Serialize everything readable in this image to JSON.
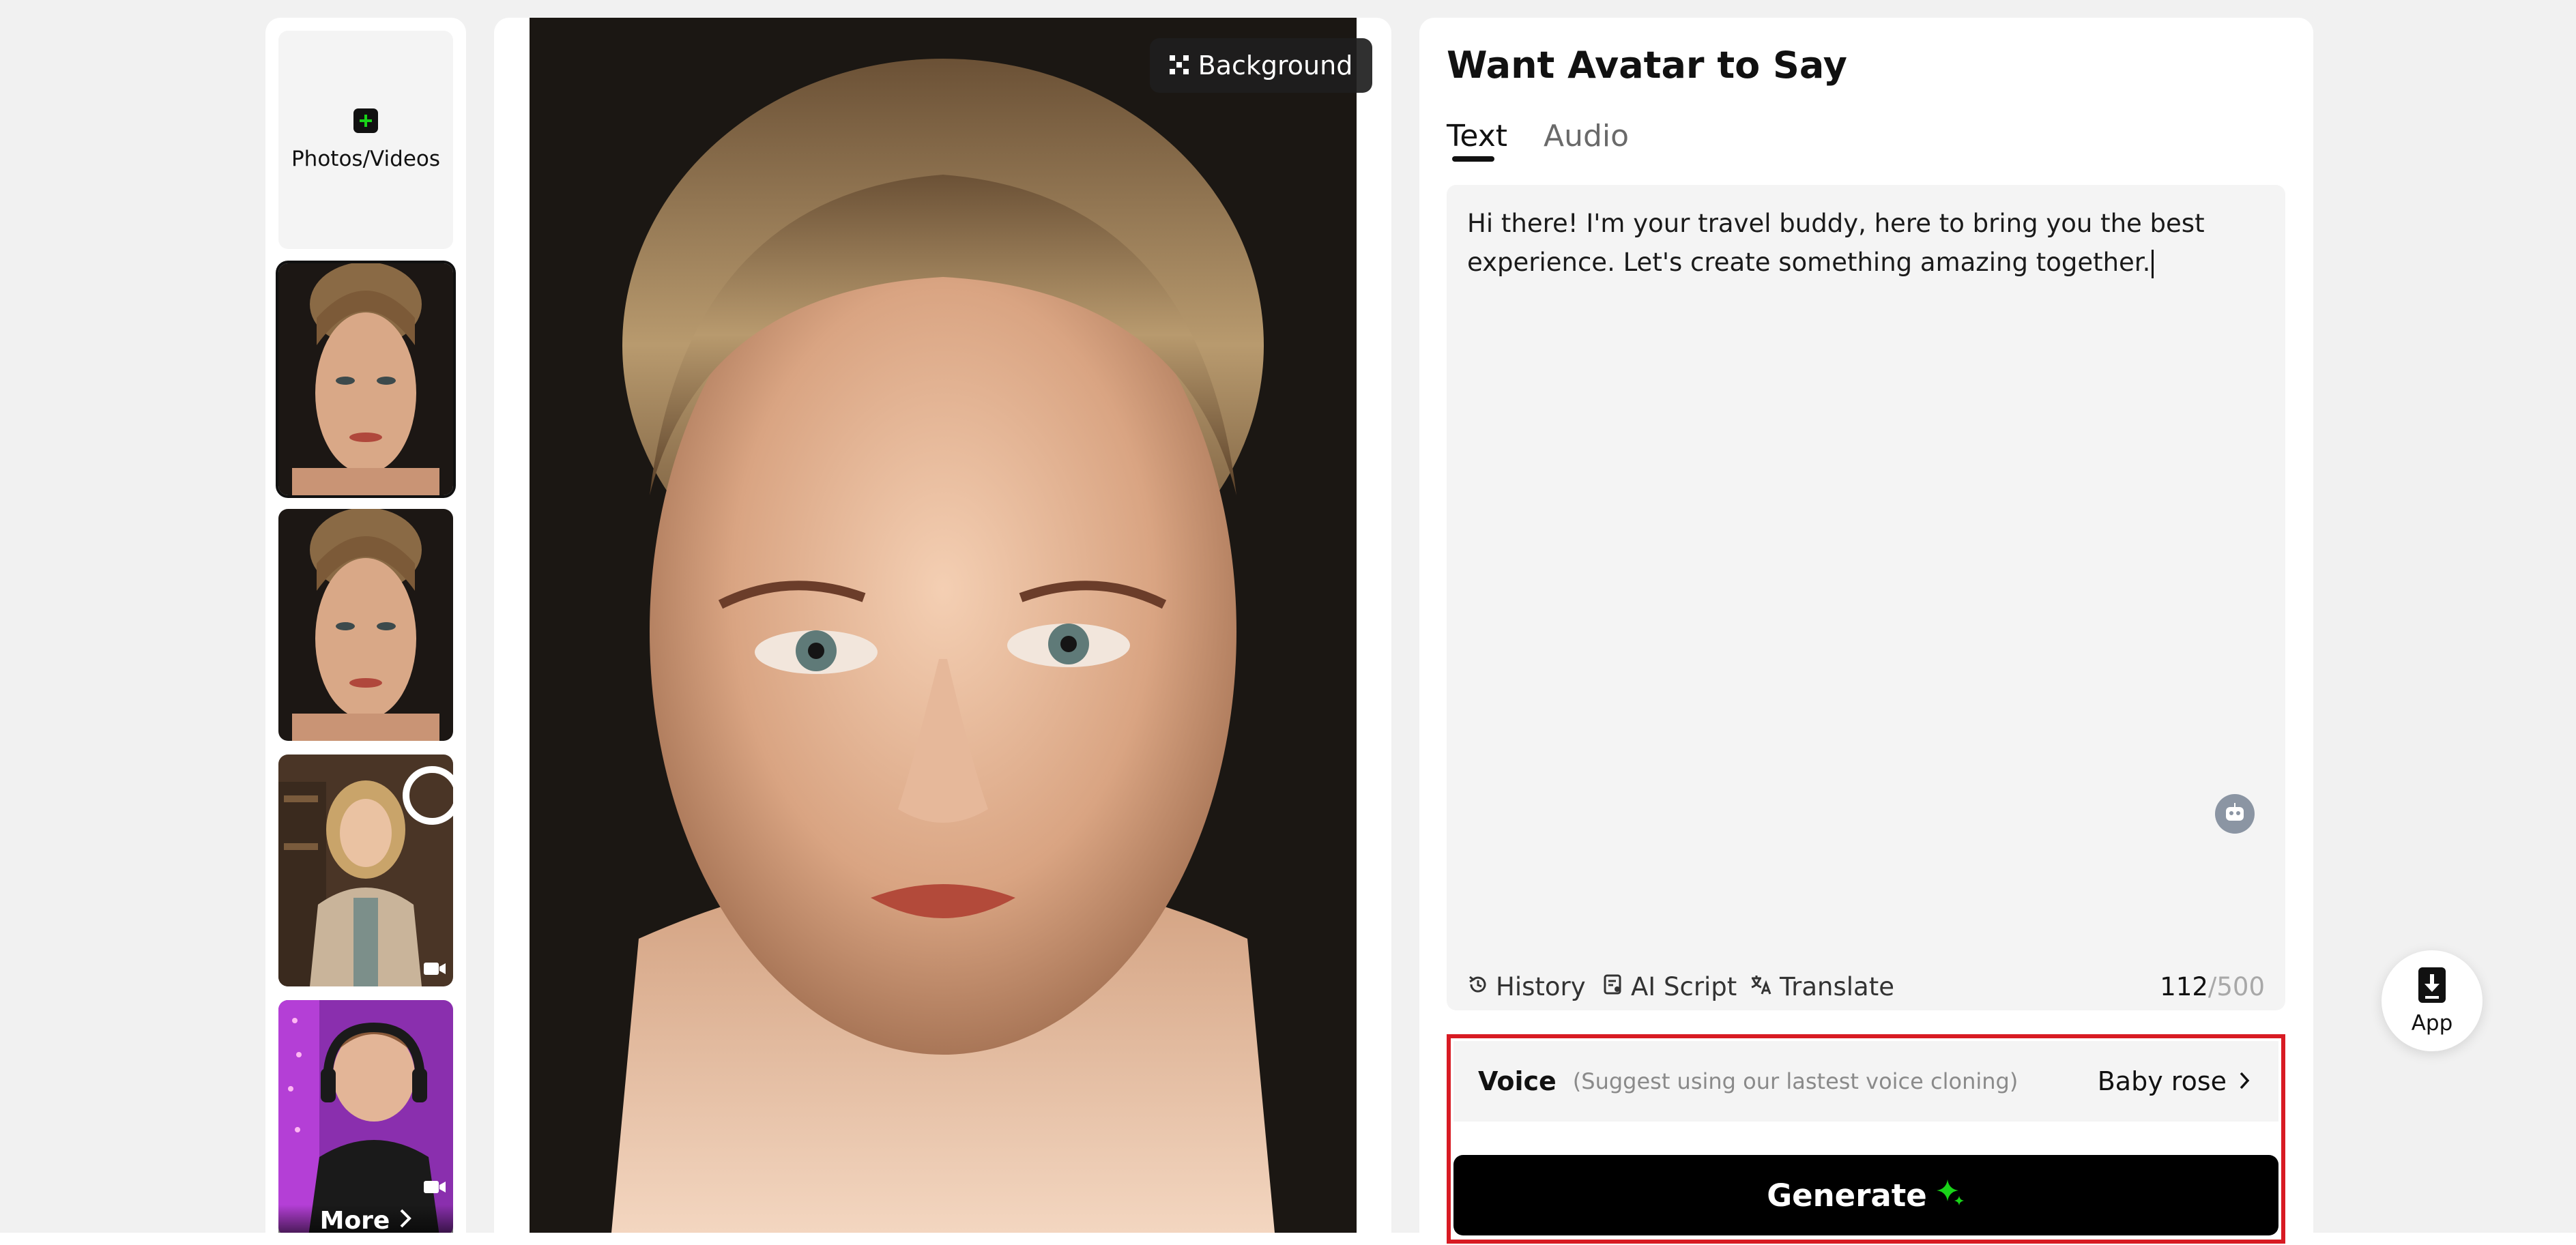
{
  "sidebar": {
    "upload_label": "Photos/Videos",
    "upload_icon": "plus-icon",
    "more_label": "More",
    "thumbnails": [
      {
        "name": "woman-portrait-closeup",
        "selected": true
      },
      {
        "name": "woman-portrait-closeup-2",
        "selected": false
      },
      {
        "name": "woman-presenter-video",
        "selected": false,
        "badge_icon": "video-camera-icon"
      },
      {
        "name": "man-headphones-video",
        "selected": false,
        "badge_icon": "video-camera-icon"
      }
    ]
  },
  "preview": {
    "background_label": "Background",
    "background_icon": "background-pattern-icon"
  },
  "panel": {
    "title": "Want Avatar to Say",
    "tabs": [
      {
        "label": "Text",
        "active": true
      },
      {
        "label": "Audio",
        "active": false
      }
    ],
    "script": "Hi there! I'm your travel buddy, here to bring you the best experience. Let's create something amazing together.",
    "tools": {
      "history": "History",
      "ai_script": "AI Script",
      "translate": "Translate"
    },
    "count": "112",
    "max": "/500",
    "voice": {
      "label": "Voice",
      "hint": "(Suggest using our lastest voice cloning)",
      "value": "Baby rose"
    },
    "generate_label": "Generate"
  },
  "app_button": {
    "label": "App"
  },
  "colors": {
    "accent_green": "#19d319",
    "highlight_red": "#d81b23",
    "button_black": "#000000"
  }
}
